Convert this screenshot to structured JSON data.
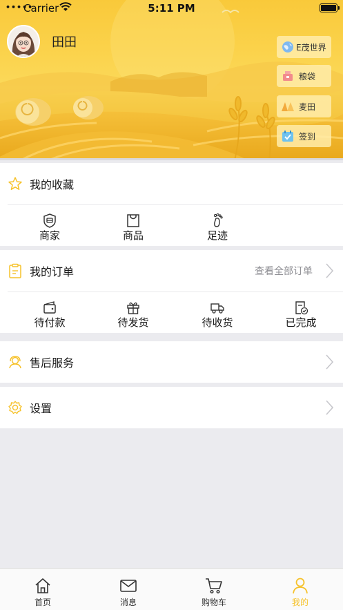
{
  "status_bar": {
    "carrier": "Carrier",
    "time": "5:11 PM"
  },
  "profile": {
    "name": "田田"
  },
  "quick_actions": [
    {
      "label": "E茂世界",
      "icon": "globe-icon"
    },
    {
      "label": "粮袋",
      "icon": "bag-icon"
    },
    {
      "label": "麦田",
      "icon": "field-icon"
    },
    {
      "label": "签到",
      "icon": "calendar-check-icon"
    }
  ],
  "favorites": {
    "title": "我的收藏",
    "items": [
      {
        "label": "商家",
        "icon": "shop-badge-icon"
      },
      {
        "label": "商品",
        "icon": "shopping-bag-icon"
      },
      {
        "label": "足迹",
        "icon": "footprint-icon"
      }
    ]
  },
  "orders": {
    "title": "我的订单",
    "view_all": "查看全部订单",
    "items": [
      {
        "label": "待付款",
        "icon": "wallet-icon"
      },
      {
        "label": "待发货",
        "icon": "gift-icon"
      },
      {
        "label": "待收货",
        "icon": "truck-icon"
      },
      {
        "label": "已完成",
        "icon": "done-icon"
      }
    ]
  },
  "after_sales": {
    "title": "售后服务"
  },
  "settings": {
    "title": "设置"
  },
  "tabbar": {
    "items": [
      {
        "label": "首页",
        "icon": "home-icon"
      },
      {
        "label": "消息",
        "icon": "mail-icon"
      },
      {
        "label": "购物车",
        "icon": "cart-icon"
      },
      {
        "label": "我的",
        "icon": "user-icon"
      }
    ],
    "active_index": 3,
    "accent_color": "#f6c22b"
  },
  "colors": {
    "banner": "#fbd24a",
    "accent": "#f6c22b",
    "background": "#ebebef"
  }
}
